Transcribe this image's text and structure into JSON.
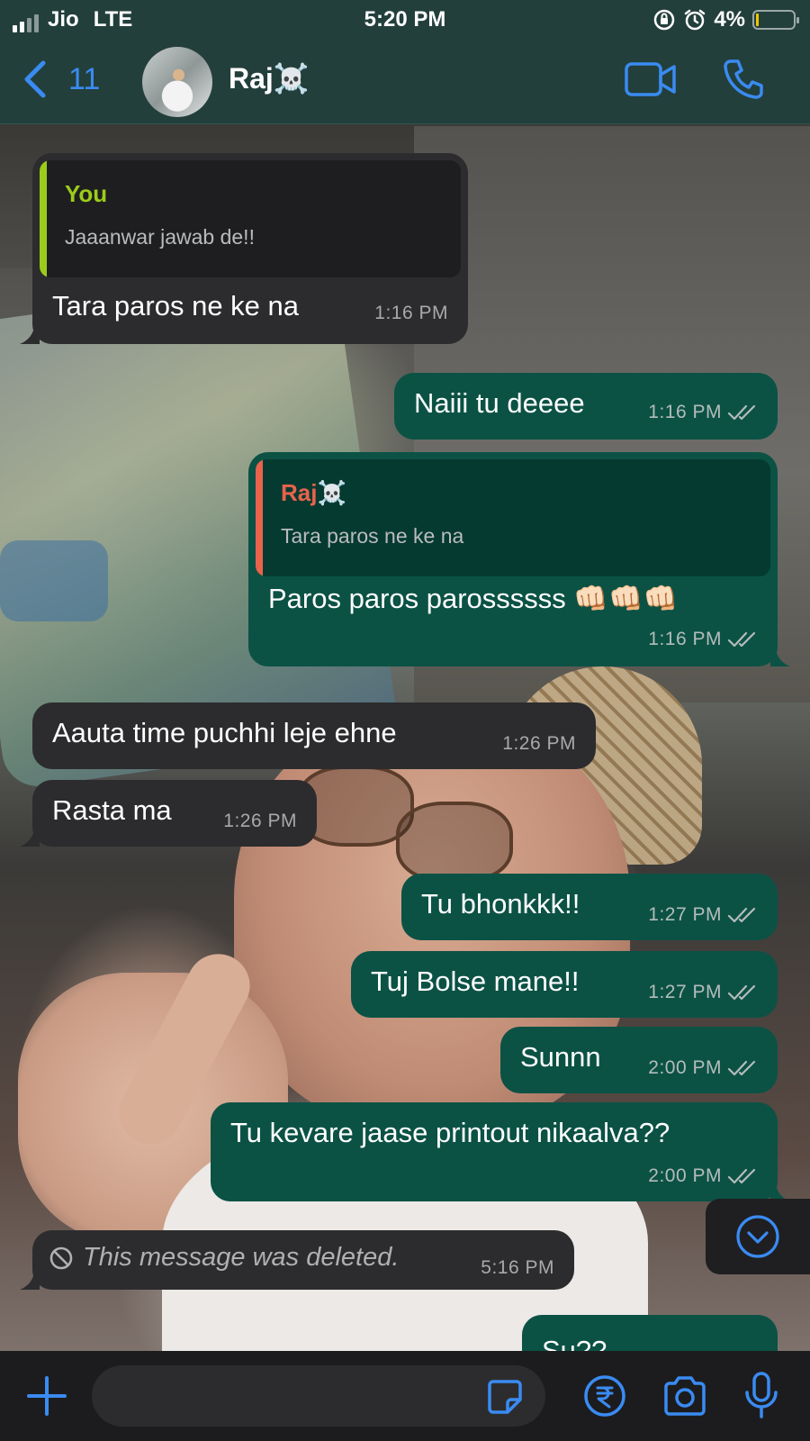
{
  "status_bar": {
    "carrier": "Jio",
    "network": "LTE",
    "time": "5:20 PM",
    "battery": "4%",
    "battery_level": 0.04
  },
  "header": {
    "back_count": "11",
    "contact_name": "Raj☠️",
    "icons": [
      "chevron-left-icon",
      "video-call-icon",
      "phone-icon"
    ]
  },
  "messages": [
    {
      "direction": "in",
      "quoted": {
        "name": "You",
        "text": "Jaaanwar jawab de!!"
      },
      "text": "Tara paros ne ke na",
      "time": "1:16 PM"
    },
    {
      "direction": "out",
      "text": "Naiii tu deeee",
      "time": "1:16 PM"
    },
    {
      "direction": "out",
      "quoted": {
        "name": "Raj☠️",
        "text": "Tara paros ne ke na"
      },
      "text": "Paros paros parossssss 👊🏻👊🏻👊🏻",
      "time": "1:16 PM"
    },
    {
      "direction": "in",
      "text": "Aauta time puchhi leje ehne",
      "time": "1:26 PM"
    },
    {
      "direction": "in",
      "text": "Rasta ma",
      "time": "1:26 PM"
    },
    {
      "direction": "out",
      "text": "Tu bhonkkk!!",
      "time": "1:27 PM"
    },
    {
      "direction": "out",
      "text": "Tuj Bolse mane!!",
      "time": "1:27 PM"
    },
    {
      "direction": "out",
      "text": "Sunnn",
      "time": "2:00 PM"
    },
    {
      "direction": "out",
      "text": "Tu kevare jaase printout nikaalva??",
      "time": "2:00 PM"
    },
    {
      "direction": "in",
      "text": "This message was deleted.",
      "time": "5:16 PM",
      "deleted": true
    },
    {
      "direction": "out",
      "text": "Su??",
      "time": ""
    }
  ],
  "input_bar": {
    "icons": [
      "plus-icon",
      "sticker-icon",
      "rupee-payment-icon",
      "camera-icon",
      "microphone-icon"
    ]
  },
  "colors": {
    "header_bg": "#233f3b",
    "incoming_bubble": "#2c2c2e",
    "outgoing_bubble": "#0b5245",
    "accent_blue": "#3a8bf2",
    "quote_you": "#9ccc1a",
    "quote_raj": "#e8634c"
  }
}
